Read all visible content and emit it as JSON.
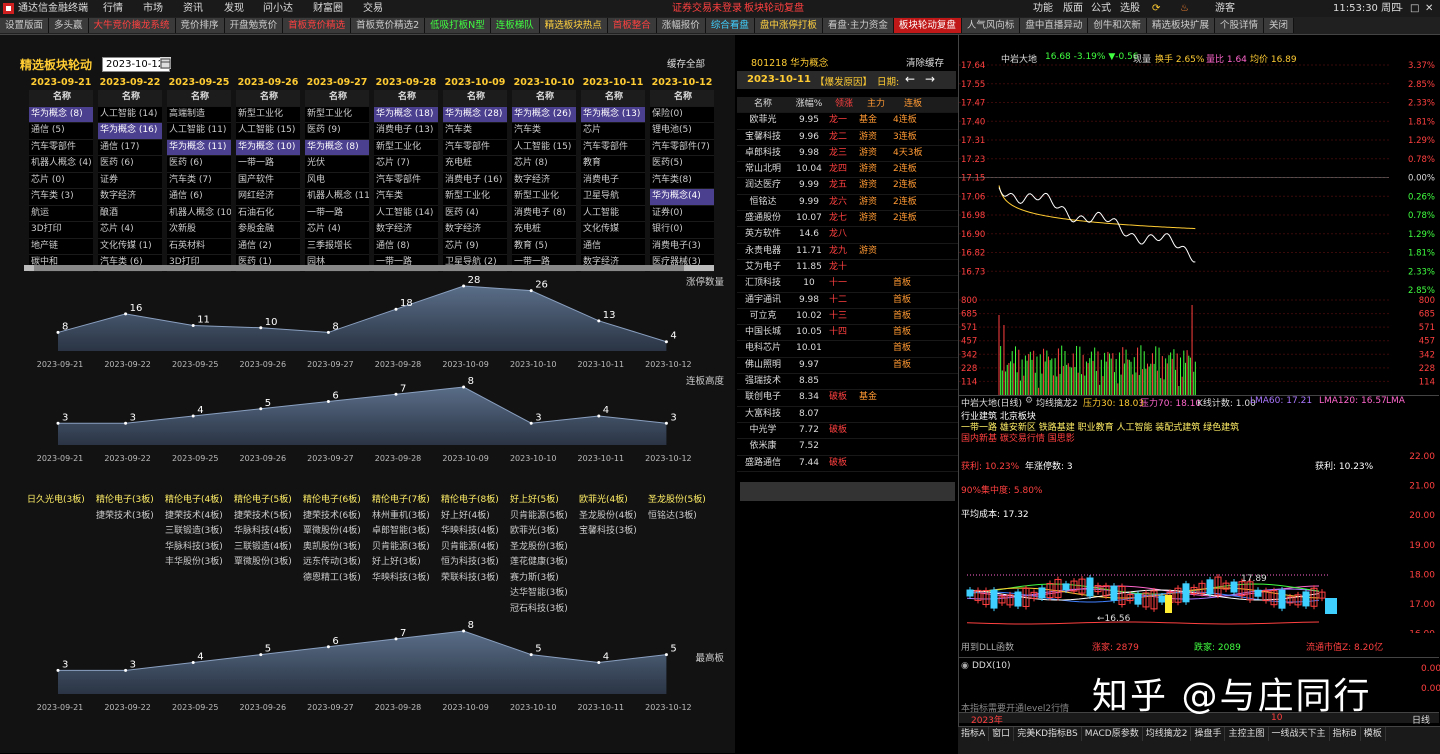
{
  "menubar": {
    "app_title": "通达信金融终端",
    "menus": [
      "行情",
      "市场",
      "资讯",
      "发现",
      "问小达",
      "财富圈",
      "交易"
    ],
    "broker_notice": "证券交易未登录",
    "page_name": "板块轮动复盘",
    "right_items": [
      "功能",
      "版面",
      "公式",
      "选股",
      "游客"
    ],
    "clock": "11:53:30 周四"
  },
  "tabs": [
    {
      "label": "设置版面",
      "style": ""
    },
    {
      "label": "多头赢",
      "style": ""
    },
    {
      "label": "大牛竞价擒龙系统",
      "style": "red"
    },
    {
      "label": "竞价排序",
      "style": ""
    },
    {
      "label": "开盘勉竞价",
      "style": ""
    },
    {
      "label": "首板竞价精选",
      "style": "red"
    },
    {
      "label": "首板竞价精选2",
      "style": ""
    },
    {
      "label": "低吸打板N型",
      "style": "green"
    },
    {
      "label": "连板梯队",
      "style": "green"
    },
    {
      "label": "精选板块热点",
      "style": "yellow"
    },
    {
      "label": "首板整合",
      "style": "red"
    },
    {
      "label": "涨幅报价",
      "style": ""
    },
    {
      "label": "综合看盘",
      "style": "cyan"
    },
    {
      "label": "盘中涨停打板",
      "style": "yellow"
    },
    {
      "label": "看盘·主力资金",
      "style": ""
    },
    {
      "label": "板块轮动复盘",
      "style": "active"
    },
    {
      "label": "人气风向标",
      "style": ""
    },
    {
      "label": "盘中直播异动",
      "style": ""
    },
    {
      "label": "创牛和次新",
      "style": ""
    },
    {
      "label": "精选板块扩展",
      "style": ""
    },
    {
      "label": "个股详情",
      "style": ""
    },
    {
      "label": "关闭",
      "style": ""
    }
  ],
  "left": {
    "title": "精选板块轮动",
    "date_value": "2023-10-12",
    "cache_all": "缓存全部",
    "col_header": "名称",
    "columns": [
      {
        "date": "2023-09-21",
        "items": [
          "华为概念 (8)",
          "通信 (5)",
          "汽车零部件",
          "机器人概念 (4)",
          "芯片 (0)",
          "汽车类 (3)",
          "航运",
          "3D打印",
          "地产链",
          "碳中和"
        ],
        "hl": [
          0
        ]
      },
      {
        "date": "2023-09-22",
        "items": [
          "人工智能 (14)",
          "华为概念 (16)",
          "通信 (17)",
          "医药 (6)",
          "证券",
          "数字经济",
          "酿酒",
          "芯片 (4)",
          "文化传媒 (1)",
          "汽车类 (6)"
        ],
        "hl": [
          1
        ]
      },
      {
        "date": "2023-09-25",
        "items": [
          "高端制造",
          "人工智能 (11)",
          "华为概念 (11)",
          "医药 (6)",
          "汽车类 (7)",
          "通信 (6)",
          "机器人概念 (10",
          "次新股",
          "石英材料",
          "3D打印"
        ],
        "hl": [
          2
        ]
      },
      {
        "date": "2023-09-26",
        "items": [
          "新型工业化",
          "人工智能 (15)",
          "华为概念 (10)",
          "一带一路",
          "国产软件",
          "网红经济",
          "石油石化",
          "参股金融",
          "通信 (2)",
          "医药 (1)"
        ],
        "hl": [
          2
        ]
      },
      {
        "date": "2023-09-27",
        "items": [
          "新型工业化",
          "医药 (9)",
          "华为概念 (8)",
          "光伏",
          "风电",
          "机器人概念 (11",
          "一带一路",
          "芯片 (4)",
          "三季报增长",
          "园林"
        ],
        "hl": [
          2
        ]
      },
      {
        "date": "2023-09-28",
        "items": [
          "华为概念 (18)",
          "消费电子 (13)",
          "新型工业化",
          "芯片 (7)",
          "汽车零部件",
          "汽车类",
          "人工智能 (14)",
          "数字经济",
          "通信 (8)",
          "一带一路"
        ],
        "hl": [
          0
        ]
      },
      {
        "date": "2023-10-09",
        "items": [
          "华为概念 (28)",
          "汽车类",
          "汽车零部件",
          "充电桩",
          "消费电子 (16)",
          "新型工业化",
          "医药 (4)",
          "数字经济",
          "芯片 (9)",
          "卫星导航 (2)"
        ],
        "hl": [
          0
        ]
      },
      {
        "date": "2023-10-10",
        "items": [
          "华为概念 (26)",
          "汽车类",
          "人工智能 (15)",
          "芯片 (8)",
          "数字经济",
          "新型工业化",
          "消费电子 (8)",
          "充电桩",
          "教育 (5)",
          "一带一路"
        ],
        "hl": [
          0
        ]
      },
      {
        "date": "2023-10-11",
        "items": [
          "华为概念 (13)",
          "芯片",
          "汽车零部件",
          "教育",
          "消费电子",
          "卫星导航",
          "人工智能",
          "文化传媒",
          "通信",
          "数字经济"
        ],
        "hl": [
          0
        ]
      },
      {
        "date": "2023-10-12",
        "items": [
          "保险(0)",
          "锂电池(5)",
          "汽车零部件(7)",
          "医药(5)",
          "汽车类(8)",
          "华为概念(4)",
          "证券(0)",
          "银行(0)",
          "消费电子(3)",
          "医疗器械(3)"
        ],
        "hl": [
          5
        ]
      }
    ],
    "chart_dates": [
      "2023-09-21",
      "2023-09-22",
      "2023-09-25",
      "2023-09-26",
      "2023-09-27",
      "2023-09-28",
      "2023-10-09",
      "2023-10-10",
      "2023-10-11",
      "2023-10-12"
    ],
    "chart1_title": "涨停数量",
    "chart1_values": [
      8,
      16,
      11,
      10,
      8,
      18,
      28,
      26,
      13,
      4
    ],
    "chart2_title": "连板高度",
    "chart2_values": [
      3,
      3,
      4,
      5,
      6,
      7,
      8,
      3,
      4,
      3
    ],
    "chart3_title": "最高板",
    "chart3_values": [
      3,
      3,
      4,
      5,
      6,
      7,
      8,
      5,
      4,
      5
    ],
    "stock_columns": [
      [
        "日久光电(3板)"
      ],
      [
        "精伦电子(3板)",
        "捷荣技术(3板)"
      ],
      [
        "精伦电子(4板)",
        "捷荣技术(4板)",
        "三联锻造(3板)",
        "华脉科技(3板)",
        "丰华股份(3板)"
      ],
      [
        "精伦电子(5板)",
        "捷荣技术(5板)",
        "华脉科技(4板)",
        "三联锻造(4板)",
        "覃微股份(3板)"
      ],
      [
        "精伦电子(6板)",
        "捷荣技术(6板)",
        "覃微股份(4板)",
        "奥凯股份(3板)",
        "远东传动(3板)",
        "德恩精工(3板)"
      ],
      [
        "精伦电子(7板)",
        "林州重机(3板)",
        "卓郎智能(3板)",
        "贝肯能源(3板)",
        "好上好(3板)",
        "华映科技(3板)"
      ],
      [
        "精伦电子(8板)",
        "好上好(4板)",
        "华映科技(4板)",
        "贝肯能源(4板)",
        "恒为科技(3板)",
        "荣联科技(3板)"
      ],
      [
        "好上好(5板)",
        "贝肯能源(5板)",
        "欧菲光(3板)",
        "圣龙股份(3板)",
        "莲花健康(3板)",
        "赛力斯(3板)",
        "达华智能(3板)",
        "冠石科技(3板)"
      ],
      [
        "欧菲光(4板)",
        "圣龙股份(4板)",
        "宝馨科技(3板)"
      ],
      [
        "圣龙股份(5板)",
        "恒铭达(3板)"
      ]
    ]
  },
  "middle": {
    "sector_code": "801218 华为概念",
    "clear_cache": "清除缓存",
    "date": "2023-10-11",
    "reason_btn": "【爆发原因】",
    "date_label": "日期:",
    "arrow_left": "←",
    "arrow_right": "→",
    "headers": [
      "名称",
      "涨幅%",
      "领涨",
      "主力",
      "连板"
    ],
    "rows": [
      [
        "欧菲光",
        "9.95",
        "龙一",
        "基金",
        "4连板"
      ],
      [
        "宝馨科技",
        "9.96",
        "龙二",
        "游资",
        "3连板"
      ],
      [
        "卓郎科技",
        "9.98",
        "龙三",
        "游资",
        "4天3板"
      ],
      [
        "常山北明",
        "10.04",
        "龙四",
        "游资",
        "2连板"
      ],
      [
        "润达医疗",
        "9.99",
        "龙五",
        "游资",
        "2连板"
      ],
      [
        "恒铭达",
        "9.99",
        "龙六",
        "游资",
        "2连板"
      ],
      [
        "盛通股份",
        "10.07",
        "龙七",
        "游资",
        "2连板"
      ],
      [
        "英方软件",
        "14.6",
        "龙八",
        "",
        ""
      ],
      [
        "永贵电器",
        "11.71",
        "龙九",
        "游资",
        ""
      ],
      [
        "艾为电子",
        "11.85",
        "龙十",
        "",
        ""
      ],
      [
        "汇顶科技",
        "10",
        "十一",
        "",
        "首板"
      ],
      [
        "通宇通讯",
        "9.98",
        "十二",
        "",
        "首板"
      ],
      [
        "可立克",
        "10.02",
        "十三",
        "",
        "首板"
      ],
      [
        "中国长城",
        "10.05",
        "十四",
        "",
        "首板"
      ],
      [
        "电科芯片",
        "10.01",
        "",
        "",
        "首板"
      ],
      [
        "佛山照明",
        "9.97",
        "",
        "",
        "首板"
      ],
      [
        "强瑞技术",
        "8.85",
        "",
        "",
        ""
      ],
      [
        "联创电子",
        "8.34",
        "破板",
        "基金",
        ""
      ],
      [
        "大富科技",
        "8.07",
        "",
        "",
        ""
      ],
      [
        "中光学",
        "7.72",
        "破板",
        "",
        ""
      ],
      [
        "依米康",
        "7.52",
        "",
        "",
        ""
      ],
      [
        "盛路通信",
        "7.44",
        "破板",
        "",
        ""
      ]
    ]
  },
  "right": {
    "stock_name": "中岩大地",
    "quote": "16.68 -3.19% ▼-0.56",
    "vol_ratio_label": "现量",
    "turnover": "换手 2.65%",
    "liang_bi": "量比 1.64",
    "avg_price": "均价 16.89",
    "price_ticks": [
      "17.64",
      "17.55",
      "17.47",
      "17.40",
      "17.31",
      "17.23",
      "17.15",
      "17.06",
      "16.98",
      "16.90",
      "16.82",
      "16.73"
    ],
    "pct_ticks": [
      "3.37%",
      "2.85%",
      "2.33%",
      "1.81%",
      "1.29%",
      "0.78%",
      "0.00%",
      "0.26%",
      "0.78%",
      "1.29%",
      "1.81%",
      "2.33%",
      "2.85%"
    ],
    "vol_ticks": [
      "800",
      "685",
      "571",
      "457",
      "342",
      "228",
      "114"
    ],
    "time_ticks": [
      "09:30",
      "10:30",
      "13:00",
      "14:00",
      "15:00"
    ],
    "daily_label": "中岩大地(日线)",
    "indicator_name": "均线擒龙2",
    "pressure_1": "压力30: 18.03",
    "pressure_2": "压力70: 18.10",
    "k_count": "K线计数: 1.00",
    "lma60": "LMA60: 17.21",
    "lma120": "LMA120: 16.57",
    "lma_tail": "LMA",
    "industry_line": "行业建筑    北京板块",
    "concept_line1": "一带一路 雄安新区 铁路基建 职业教育 人工智能 装配式建筑 绿色建筑",
    "concept_line2": "国内新基 碳交易行情 国思影",
    "profit_label": "获利: 10.23%",
    "year_limit": "年涨停数: 3",
    "profit_right": "获利: 10.23%",
    "chip_concentration": "90%集中度: 5.80%",
    "avg_cost": "平均成本: 17.32",
    "k_price_ticks": [
      "22.00",
      "21.00",
      "20.00",
      "19.00",
      "18.00",
      "17.00",
      "16.00"
    ],
    "low_label": "16.56",
    "high_label": "17.89",
    "dll_label": "用到DLL函数",
    "up_count": "涨家: 2879",
    "down_count": "跌家: 2089",
    "float_mv": "流通市值Z: 8.20亿",
    "ddx_label": "DDX(10)",
    "ddx_ticks": [
      "0.00",
      "0.00"
    ],
    "level2_note": "本指标需要开通level2行情",
    "year_label": "2023年",
    "month_label": "10",
    "day_line": "日线",
    "watermark": "知乎 @与庄同行"
  },
  "statusbar": {
    "buttons": [
      "指标A",
      "窗口",
      "完美KD指标BS",
      "MACD原参数",
      "均线擒龙2",
      "操盘手",
      "主控主图",
      "一线战天下主",
      "指标B",
      "模板"
    ]
  },
  "colors": {
    "accent_red": "#c01818",
    "yellow": "#ffcc33",
    "highlight_purple": "#4b3f8f"
  }
}
